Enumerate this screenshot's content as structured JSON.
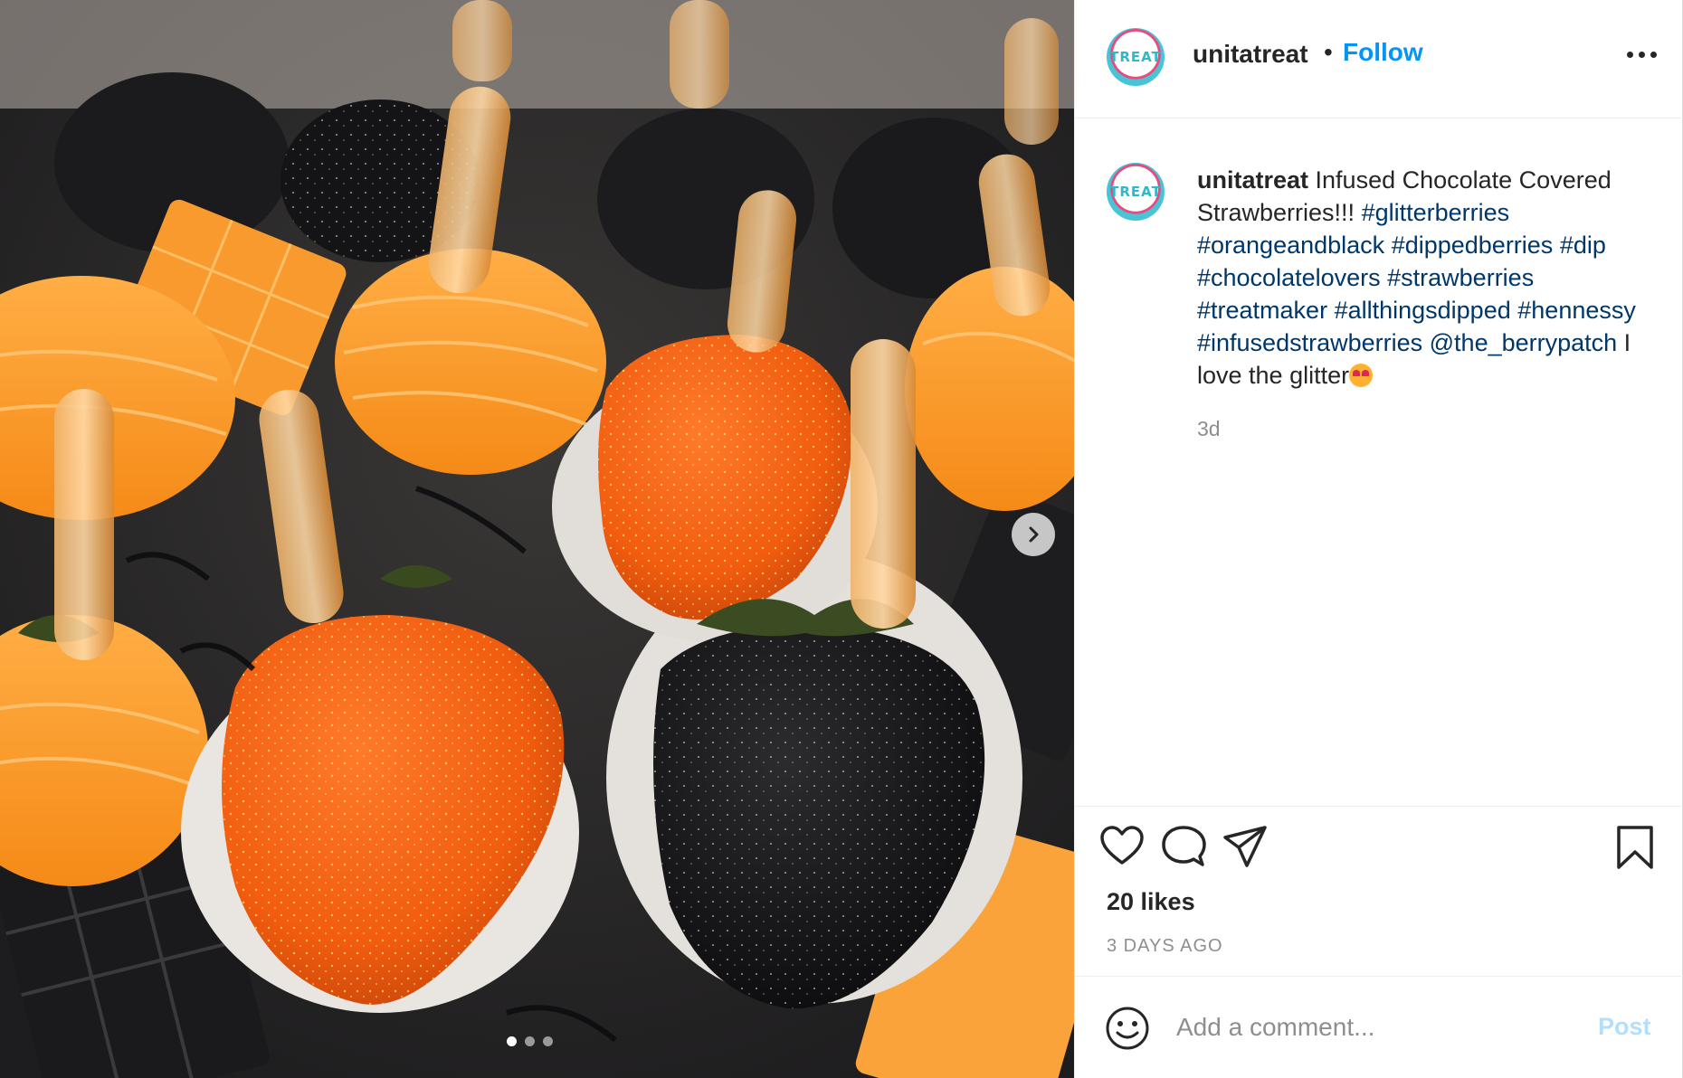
{
  "post": {
    "username": "unitatreat",
    "separator": "•",
    "follow_label": "Follow",
    "avatar_text": "TREAT",
    "caption": {
      "username": "unitatreat",
      "text_intro": " Infused Chocolate Covered Strawberries!!! ",
      "hashtags": [
        "#glitterberries",
        "#orangeandblack",
        "#dippedberries",
        "#dip",
        "#chocolatelovers",
        "#strawberries",
        "#treatmaker",
        "#allthingsdipped",
        "#hennessy",
        "#infusedstrawberries"
      ],
      "mention": "@the_berrypatch",
      "text_outro": " I love the glitter",
      "time": "3d"
    },
    "likes": "20 likes",
    "posted_ago": "3 DAYS AGO",
    "comment": {
      "placeholder": "Add a comment...",
      "post_label": "Post"
    },
    "carousel": {
      "slide_count": 3,
      "active_slide": 1
    }
  },
  "icons": {
    "more": "more-options-icon",
    "like": "heart-icon",
    "comment": "comment-bubble-icon",
    "share": "paper-plane-icon",
    "save": "bookmark-icon",
    "emoji": "smiley-icon",
    "next": "chevron-right-icon"
  },
  "colors": {
    "follow_blue": "#0095f6",
    "hashtag_link": "#00376b",
    "post_disabled": "#b2dffc",
    "muted_text": "#8e8e8e"
  }
}
